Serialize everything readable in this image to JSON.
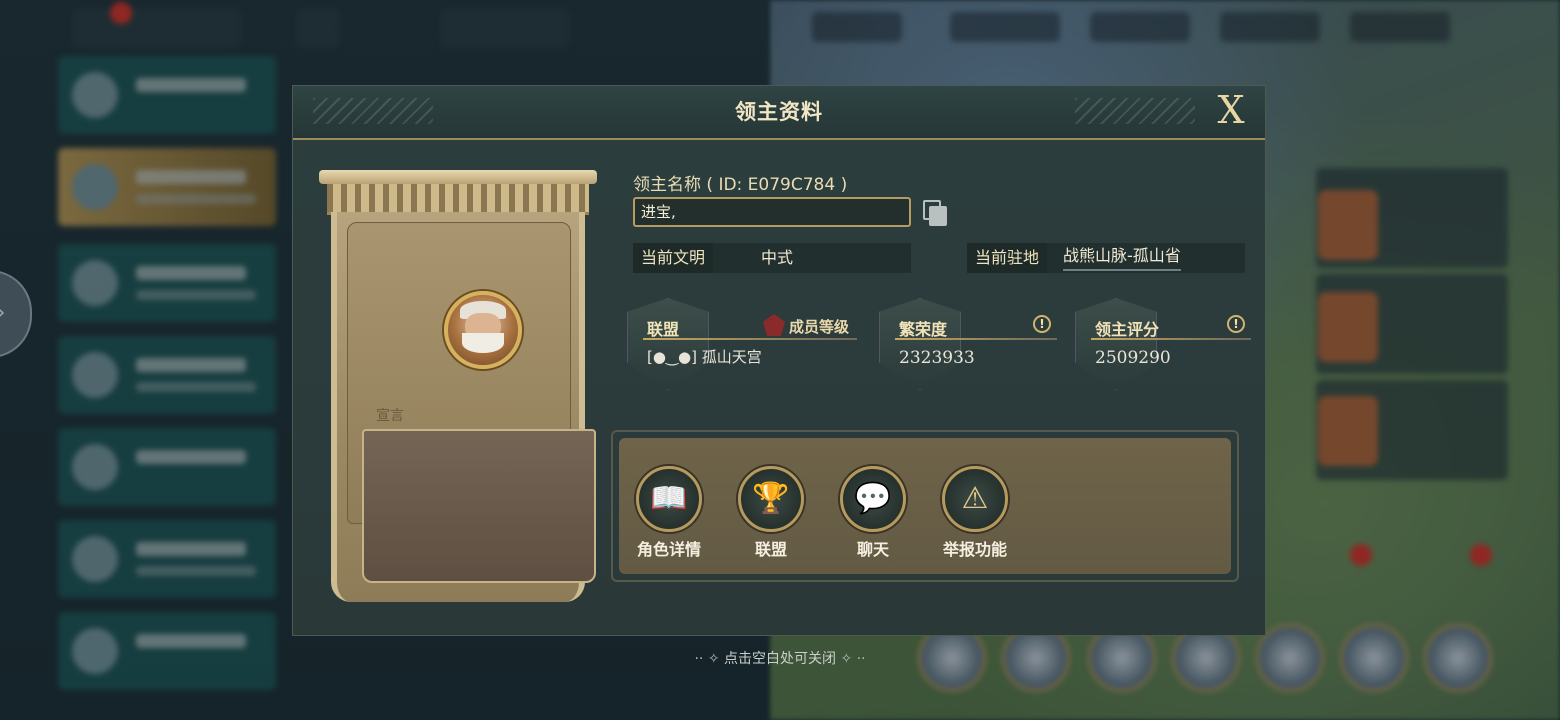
{
  "dialog": {
    "title": "领主资料",
    "close_label": "X"
  },
  "lord": {
    "name_label": "领主名称 ( ID: E079C784 )",
    "name_value": "进宝,",
    "declaration_label": "宣言",
    "civilization_label": "当前文明",
    "civilization_value": "中式",
    "location_label": "当前驻地",
    "location_value": "战熊山脉-孤山省"
  },
  "stats": {
    "alliance_label": "联盟",
    "member_rank_label": "成员等级",
    "alliance_name": "[●‿●] 孤山天宫",
    "prosperity_label": "繁荣度",
    "prosperity_value": "2323933",
    "lord_score_label": "领主评分",
    "lord_score_value": "2509290"
  },
  "actions": [
    {
      "label": "角色详情",
      "icon": "book-icon"
    },
    {
      "label": "联盟",
      "icon": "trophy-icon"
    },
    {
      "label": "聊天",
      "icon": "chat-icon"
    },
    {
      "label": "举报功能",
      "icon": "warning-icon"
    }
  ],
  "footer": {
    "hint": "点击空白处可关闭"
  },
  "colors": {
    "accent_gold": "#b59b62",
    "panel_dark": "#2d3e3e",
    "text_cream": "#e9dcb4"
  }
}
